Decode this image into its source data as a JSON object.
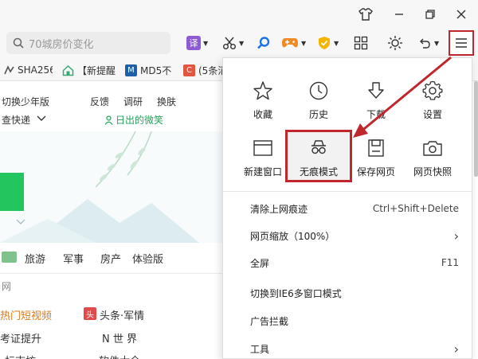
{
  "toolbar": {
    "search_placeholder": "70城房价变化"
  },
  "bookmarks": [
    {
      "label": "SHA256",
      "icon": "sha-icon",
      "color": "#555555"
    },
    {
      "label": "【新提醒",
      "icon": "home-icon",
      "color": "#3aa776"
    },
    {
      "label": "MD5不",
      "icon": "m-icon",
      "color": "#1f5fa8"
    },
    {
      "label": "(5条消",
      "icon": "c-icon",
      "color": "#e2553e"
    }
  ],
  "page": {
    "left_items": [
      "切换少年版",
      "查快递"
    ],
    "mid_items": [
      "反馈",
      "调研",
      "换肤"
    ],
    "sunrise_link": "日出的微笑",
    "nav": [
      "旅游",
      "军事",
      "房产",
      "体验版"
    ],
    "section_label": "网",
    "links_left": [
      "热门短视频",
      "考证提升",
      "标志坊"
    ],
    "links_right": [
      "头条·军情",
      "N 世 界",
      "软件大全"
    ],
    "toutiao_badge": "头"
  },
  "menu": {
    "icons_row1": [
      {
        "label": "收藏",
        "icon": "star-icon"
      },
      {
        "label": "历史",
        "icon": "clock-icon"
      },
      {
        "label": "下载",
        "icon": "download-icon"
      },
      {
        "label": "设置",
        "icon": "gear-icon"
      }
    ],
    "icons_row2": [
      {
        "label": "新建窗口",
        "icon": "new-window-icon"
      },
      {
        "label": "无痕模式",
        "icon": "incognito-icon"
      },
      {
        "label": "保存网页",
        "icon": "save-icon"
      },
      {
        "label": "网页快照",
        "icon": "camera-icon"
      }
    ],
    "items": [
      {
        "label": "清除上网痕迹",
        "right": "Ctrl+Shift+Delete"
      },
      {
        "label": "网页缩放（100%）",
        "right": "›"
      },
      {
        "label": "全屏",
        "right": "F11"
      },
      {
        "label": "切换到IE6多窗口模式",
        "right": ""
      },
      {
        "label": "广告拦截",
        "right": ""
      },
      {
        "label": "工具",
        "right": "›"
      }
    ]
  },
  "colors": {
    "highlight": "#c0272d",
    "sunrise_green": "#22a35a"
  }
}
